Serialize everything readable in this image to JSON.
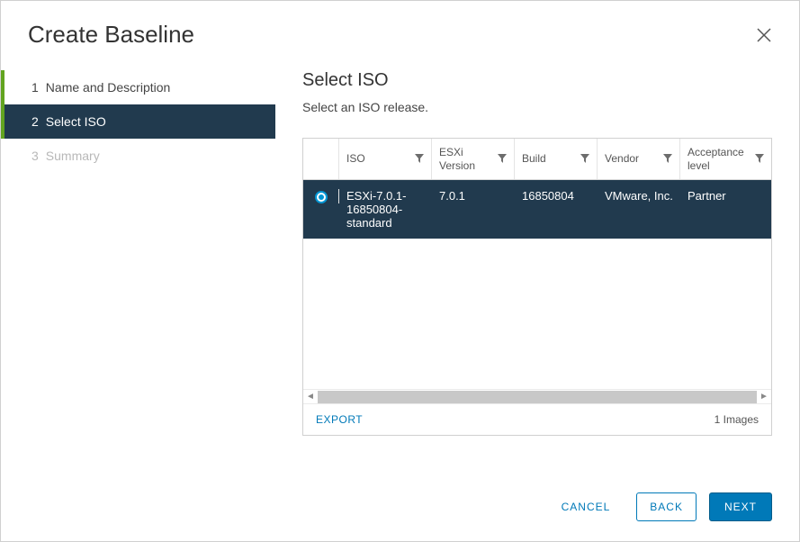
{
  "dialog": {
    "title": "Create Baseline"
  },
  "steps": [
    {
      "num": "1",
      "label": "Name and Description",
      "state": "done"
    },
    {
      "num": "2",
      "label": "Select ISO",
      "state": "active"
    },
    {
      "num": "3",
      "label": "Summary",
      "state": "future"
    }
  ],
  "panel": {
    "title": "Select ISO",
    "subtitle": "Select an ISO release."
  },
  "table": {
    "headers": {
      "iso": "ISO",
      "version": "ESXi Version",
      "build": "Build",
      "vendor": "Vendor",
      "acceptance": "Acceptance level"
    },
    "rows": [
      {
        "selected": true,
        "iso": "ESXi-7.0.1-16850804-standard",
        "version": "7.0.1",
        "build": "16850804",
        "vendor": "VMware, Inc.",
        "acceptance": "Partner"
      }
    ],
    "export_label": "EXPORT",
    "count_label": "1 Images"
  },
  "buttons": {
    "cancel": "CANCEL",
    "back": "BACK",
    "next": "NEXT"
  }
}
